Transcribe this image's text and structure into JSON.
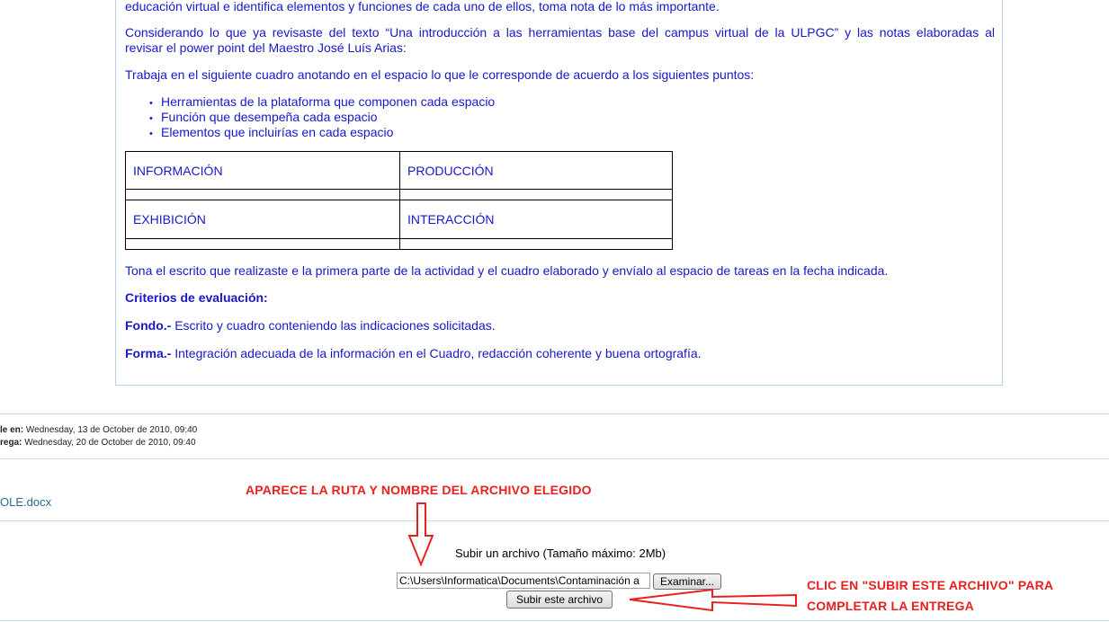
{
  "body": {
    "line_top": "educación virtual e identifica elementos y funciones de cada uno de ellos, toma nota de lo más importante.",
    "para1_line1": "Considerando lo que ya revisaste del texto “Una introducción a las herramientas base del campus virtual de la ULPGC” y las notas elaboradas al",
    "para1_line2": "revisar el power point del Maestro José Luís Arias:",
    "para2": "Trabaja en el siguiente cuadro anotando en el espacio lo que le corresponde de acuerdo a los siguientes puntos:",
    "bullets": [
      "Herramientas de la plataforma que componen cada espacio",
      "Función que desempeña cada espacio",
      "Elementos que incluirías en cada espacio"
    ],
    "bullet_glyph": "•",
    "table": {
      "c1": "INFORMACIÓN",
      "c2": "PRODUCCIÓN",
      "c3": "EXHIBICIÓN",
      "c4": "INTERACCIÓN"
    },
    "para3": "Tona el escrito que realizaste e la primera parte de la actividad y el cuadro elaborado y envíalo al espacio de tareas en la fecha indicada.",
    "criterios": "Criterios de evaluación:",
    "fondo_label": "Fondo.-",
    "fondo_text": " Escrito y cuadro conteniendo las indicaciones solicitadas.",
    "forma_label": "Forma.-",
    "forma_text": " Integración adecuada de la información en el Cuadro, redacción coherente y buena ortografía."
  },
  "dates": {
    "available_label": "le en:",
    "available_value": " Wednesday, 13 de October de 2010, 09:40",
    "due_label": "rega:",
    "due_value": " Wednesday, 20 de October de 2010, 09:40"
  },
  "submitted_file": "OLE.docx",
  "upload": {
    "label": "Subir un archivo (Tamaño máximo: 2Mb)",
    "path_value": "C:\\Users\\Informatica\\Documents\\Contaminación a",
    "browse_label": "Examinar...",
    "submit_label": "Subir este archivo"
  },
  "annotations": {
    "top": "APARECE LA RUTA Y NOMBRE DEL ARCHIVO ELEGIDO",
    "right_line1": "CLIC EN \"SUBIR ESTE ARCHIVO\" PARA",
    "right_line2": "COMPLETAR LA ENTREGA",
    "color": "#e82020"
  },
  "colors": {
    "text_blue": "#1818c8",
    "link": "#2a6a96",
    "border": "#b9d3e6"
  }
}
